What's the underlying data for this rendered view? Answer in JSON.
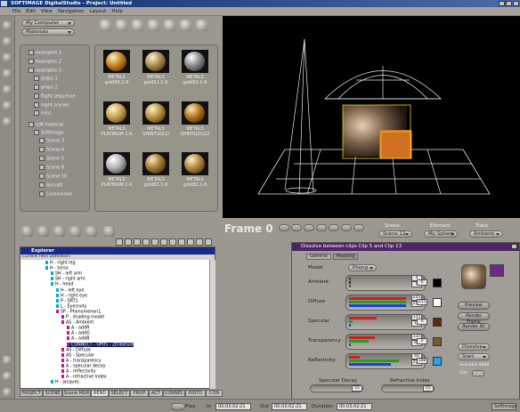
{
  "title_bar": {
    "text": "SOFTIMAGE DigitalStudio - Project: Untitled"
  },
  "menu": [
    "File",
    "Edit",
    "View",
    "Navigation",
    "Layout",
    "Help"
  ],
  "library": {
    "computer_select": "My Computer",
    "category_select": "Materials",
    "tree": [
      "examples 1",
      "examples 2",
      "examples 3",
      "props 1",
      "props 2",
      "flight sequence",
      "night scenes",
      "misc",
      "ILM material",
      "Softimage",
      "Scene 3",
      "Scene 4",
      "Scene 5",
      "Scene 8",
      "Scene 10",
      "Aircraft",
      "Locomotive"
    ],
    "thumbs": [
      {
        "line1": "METALS",
        "line2": "gold50.1-6"
      },
      {
        "line1": "METALS",
        "line2": "gold51.1-6"
      },
      {
        "line1": "METALS",
        "line2": "gold52.1-6"
      },
      {
        "line1": "METALS",
        "line2": "PLATINUM 1-6"
      },
      {
        "line1": "METALS",
        "line2": "SHINYGOLD"
      },
      {
        "line1": "METALS",
        "line2": "SHINYGOLD2"
      },
      {
        "line1": "METALS",
        "line2": "PLATINUM 1-6"
      },
      {
        "line1": "METALS",
        "line2": "gold81.1-6"
      },
      {
        "line1": "METALS",
        "line2": "gold82.1-6"
      }
    ]
  },
  "frame_label": "Frame 0",
  "selectors": {
    "scene_label": "Scene",
    "scene_value": "Scene 12",
    "element_label": "Element",
    "element_value": "My Sphere",
    "track_label": "Track",
    "track_value": "Ambient"
  },
  "explorer": {
    "title": "Explorer",
    "filter_label": "Current Filter Definition:",
    "nodes": [
      {
        "t": "H - right leg",
        "c": "#00b0c8",
        "d": 0
      },
      {
        "t": "H - torso",
        "c": "#00b0c8",
        "d": 0
      },
      {
        "t": "SH - left arm",
        "c": "#00b0c8",
        "d": 1
      },
      {
        "t": "SH - right arm",
        "c": "#00b0c8",
        "d": 1
      },
      {
        "t": "H - head",
        "c": "#00b0c8",
        "d": 1
      },
      {
        "t": "H - left eye",
        "c": "#00b0c8",
        "d": 2
      },
      {
        "t": "H - right eye",
        "c": "#00b0c8",
        "d": 2
      },
      {
        "t": "P - SRT1",
        "c": "#00b0c8",
        "d": 2
      },
      {
        "t": "L - Eyesnoty",
        "c": "#00b0c8",
        "d": 2
      },
      {
        "t": "SP - Phenomenon1",
        "c": "#c0189a",
        "d": 2
      },
      {
        "t": "P - shading model",
        "c": "#c0189a",
        "d": 3
      },
      {
        "t": "AS - Ambient",
        "c": "#c0189a",
        "d": 3
      },
      {
        "t": "A - addR",
        "c": "#c0189a",
        "d": 4
      },
      {
        "t": "A - addG",
        "c": "#c0189a",
        "d": 4
      },
      {
        "t": "A - addB",
        "c": "#c0189a",
        "d": 4
      },
      {
        "t": "CONNECT - OP05 : 2DTexture",
        "c": "#c0189a",
        "d": 4,
        "sel": true
      },
      {
        "t": "AS - Diffuse",
        "c": "#c0189a",
        "d": 3
      },
      {
        "t": "AS - Specular",
        "c": "#c0189a",
        "d": 3
      },
      {
        "t": "A - transparency",
        "c": "#c0189a",
        "d": 3
      },
      {
        "t": "A - specular decay",
        "c": "#c0189a",
        "d": 3
      },
      {
        "t": "A - reflectivity",
        "c": "#c0189a",
        "d": 3
      },
      {
        "t": "A - refractive index",
        "c": "#c0189a",
        "d": 3
      },
      {
        "t": "H - Jacques",
        "c": "#00b0c8",
        "d": 1
      }
    ]
  },
  "tabs": [
    "PROJECT",
    "SCENE",
    "Scene MGR",
    "REND",
    "SELECT",
    "PROP",
    "ACT",
    "CONNEC",
    "HISTO",
    "CON"
  ],
  "dialog": {
    "title": "Dissolve between clips Clip 5 and Clip 13",
    "tab_general": "General",
    "tab_masking": "Masking",
    "model_label": "Model",
    "model_value": "Phong",
    "rows": [
      {
        "label": "Ambient",
        "values": [
          "0",
          "0",
          "0"
        ],
        "swatch": "#000000",
        "bars": [
          "#444",
          "#333",
          "#555"
        ]
      },
      {
        "label": "Diffuse",
        "values": [
          "255",
          "255",
          "255"
        ],
        "swatch": "#ffffff",
        "bars": [
          "#d02020",
          "#20a020",
          "#2040d0"
        ]
      },
      {
        "label": "Specular",
        "values": [
          "125",
          "15",
          "0"
        ],
        "swatch": "#5a2a10",
        "bars": [
          "#d02020",
          "#20a020",
          "#2040d0"
        ]
      },
      {
        "label": "Transparency",
        "values": [
          "115",
          "87",
          "0"
        ],
        "swatch": "#7a5a2a",
        "bars": [
          "#d02020",
          "#20a020",
          "#2040d0"
        ]
      },
      {
        "label": "Reflectivity",
        "values": [
          "46",
          "224",
          "188"
        ],
        "swatch": "#30a0e8",
        "bars": [
          "#d02020",
          "#20a020",
          "#2040d0"
        ]
      }
    ],
    "specular_decay_label": "Specular Decay",
    "specular_decay": "55",
    "refractive_label": "Refractive Index",
    "refractive": "65",
    "buttons": [
      "Preview",
      "Render Frame",
      "Render All"
    ],
    "blend_select": "Dissolve",
    "start_select": "Start",
    "available_label": "Available",
    "available_value": "8888",
    "dist_label": "Dist"
  },
  "status": {
    "play": "Play",
    "in_label": "In",
    "in_value": "00:03:02:21",
    "out_label": "Out",
    "out_value": "00:03:02:21",
    "duration_label": "Duration",
    "duration_value": "00:03:02:21",
    "right": "Softimage"
  }
}
